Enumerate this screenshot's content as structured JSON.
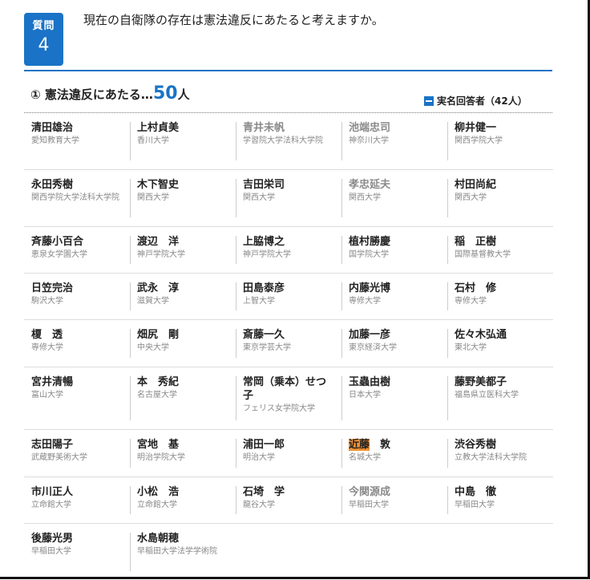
{
  "question": {
    "label": "質問",
    "number": "4",
    "text": "現在の自衛隊の存在は憲法違反にあたると考えますか。"
  },
  "section": {
    "title_prefix": "① 憲法違反にあたる…",
    "count": "50",
    "unit": "人",
    "named_label": "実名回答者（42人）"
  },
  "rows": [
    {
      "height": 70,
      "people": [
        {
          "name": "清田雄治",
          "univ": "愛知教育大学",
          "gray": false
        },
        {
          "name": "上村貞美",
          "univ": "香川大学",
          "gray": false
        },
        {
          "name": "青井未帆",
          "univ": "学習院大学法科大学院",
          "gray": true
        },
        {
          "name": "池端忠司",
          "univ": "神奈川大学",
          "gray": true
        },
        {
          "name": "柳井健一",
          "univ": "関西学院大学",
          "gray": false
        }
      ]
    },
    {
      "height": 70,
      "people": [
        {
          "name": "永田秀樹",
          "univ": "関西学院大学法科大学院",
          "gray": false
        },
        {
          "name": "木下智史",
          "univ": "関西大学",
          "gray": false
        },
        {
          "name": "吉田栄司",
          "univ": "関西大学",
          "gray": false
        },
        {
          "name": "孝忠延夫",
          "univ": "関西大学",
          "gray": true
        },
        {
          "name": "村田尚紀",
          "univ": "関西大学",
          "gray": false
        }
      ]
    },
    {
      "height": 57,
      "people": [
        {
          "name": "斉藤小百合",
          "univ": "恵泉女学園大学",
          "gray": false
        },
        {
          "name": "渡辺　洋",
          "univ": "神戸学院大学",
          "gray": false
        },
        {
          "name": "上脇博之",
          "univ": "神戸学院大学",
          "gray": false
        },
        {
          "name": "植村勝慶",
          "univ": "国学院大学",
          "gray": false
        },
        {
          "name": "稲　正樹",
          "univ": "国際基督教大学",
          "gray": false
        }
      ]
    },
    {
      "height": 57,
      "people": [
        {
          "name": "日笠完治",
          "univ": "駒沢大学",
          "gray": false
        },
        {
          "name": "武永　淳",
          "univ": "滋賀大学",
          "gray": false
        },
        {
          "name": "田島泰彦",
          "univ": "上智大学",
          "gray": false
        },
        {
          "name": "内藤光博",
          "univ": "専修大学",
          "gray": false
        },
        {
          "name": "石村　修",
          "univ": "専修大学",
          "gray": false
        }
      ]
    },
    {
      "height": 58,
      "people": [
        {
          "name": "榎　透",
          "univ": "専修大学",
          "gray": false
        },
        {
          "name": "畑尻　剛",
          "univ": "中央大学",
          "gray": false
        },
        {
          "name": "斎藤一久",
          "univ": "東京学芸大学",
          "gray": false
        },
        {
          "name": "加藤一彦",
          "univ": "東京経済大学",
          "gray": false
        },
        {
          "name": "佐々木弘通",
          "univ": "東北大学",
          "gray": false
        }
      ]
    },
    {
      "height": 77,
      "people": [
        {
          "name": "宮井清暢",
          "univ": "富山大学",
          "gray": false
        },
        {
          "name": "本　秀紀",
          "univ": "名古屋大学",
          "gray": false
        },
        {
          "name": "常岡（乗本）せつ子",
          "univ": "フェリス女学院大学",
          "gray": false
        },
        {
          "name": "玉蟲由樹",
          "univ": "日本大学",
          "gray": false
        },
        {
          "name": "藤野美都子",
          "univ": "福島県立医科大学",
          "gray": false
        }
      ]
    },
    {
      "height": 58,
      "people": [
        {
          "name": "志田陽子",
          "univ": "武蔵野美術大学",
          "gray": false
        },
        {
          "name": "宮地　基",
          "univ": "明治学院大学",
          "gray": false
        },
        {
          "name": "浦田一郎",
          "univ": "明治大学",
          "gray": false
        },
        {
          "name": "近藤　敦",
          "univ": "名城大学",
          "gray": false,
          "highlight": "近藤",
          "rest": "　敦"
        },
        {
          "name": "渋谷秀樹",
          "univ": "立教大学法科大学院",
          "gray": false
        }
      ]
    },
    {
      "height": 57,
      "people": [
        {
          "name": "市川正人",
          "univ": "立命館大学",
          "gray": false
        },
        {
          "name": "小松　浩",
          "univ": "立命館大学",
          "gray": false
        },
        {
          "name": "石埼　学",
          "univ": "龍谷大学",
          "gray": false
        },
        {
          "name": "今関源成",
          "univ": "早稲田大学",
          "gray": true
        },
        {
          "name": "中島　徹",
          "univ": "早稲田大学",
          "gray": false
        }
      ]
    },
    {
      "height": 70,
      "last": true,
      "people": [
        {
          "name": "後藤光男",
          "univ": "早稲田大学",
          "gray": false
        },
        {
          "name": "水島朝穂",
          "univ": "早稲田大学法学学術院",
          "gray": false
        }
      ]
    }
  ]
}
